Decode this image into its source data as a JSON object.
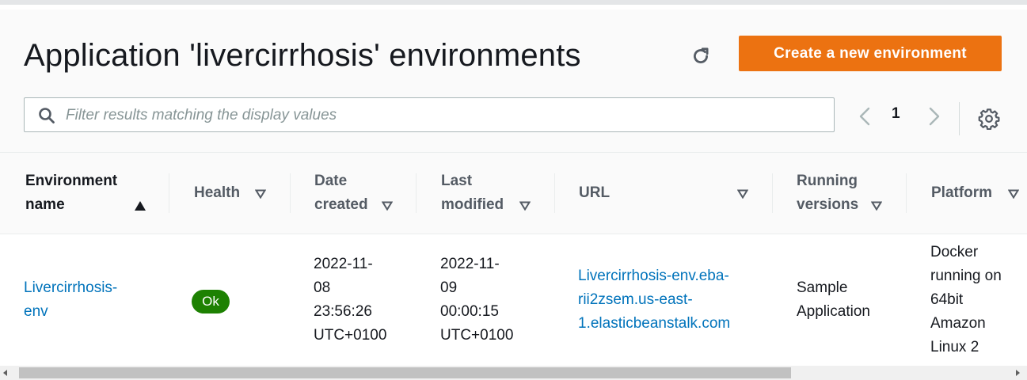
{
  "header": {
    "title": "Application 'livercirrhosis' environments",
    "refresh_icon": "refresh-icon",
    "create_button": "Create a new environment"
  },
  "filter": {
    "placeholder": "Filter results matching the display values",
    "value": ""
  },
  "pagination": {
    "current_page": "1",
    "prev_icon": "chevron-left-icon",
    "next_icon": "chevron-right-icon",
    "settings_icon": "gear-icon"
  },
  "table": {
    "columns": [
      {
        "line1": "Environment",
        "line2": "name",
        "sort": "ascending"
      },
      {
        "line1": "Health",
        "line2": "",
        "sort": "none"
      },
      {
        "line1": "Date",
        "line2": "created",
        "sort": "none"
      },
      {
        "line1": "Last",
        "line2": "modified",
        "sort": "none"
      },
      {
        "line1": "URL",
        "line2": "",
        "sort": "none"
      },
      {
        "line1": "Running",
        "line2": "versions",
        "sort": "none"
      },
      {
        "line1": "Platform",
        "line2": "",
        "sort": "none"
      }
    ],
    "rows": [
      {
        "env_name_l1": "Livercirrhosis-",
        "env_name_l2": "env",
        "health": "Ok",
        "date_created": [
          "2022-11-",
          "08",
          "23:56:26",
          "UTC+0100"
        ],
        "last_modified": [
          "2022-11-",
          "09",
          "00:00:15",
          "UTC+0100"
        ],
        "url": [
          "Livercirrhosis-env.eba-",
          "rii2zsem.us-east-",
          "1.elasticbeanstalk.com"
        ],
        "running_versions": [
          "Sample",
          "Application"
        ],
        "platform": [
          "Docker",
          "running on",
          "64bit",
          "Amazon",
          "Linux 2"
        ]
      }
    ]
  },
  "colors": {
    "accent": "#ec7211",
    "link": "#0073bb",
    "health_ok": "#1d8102"
  }
}
